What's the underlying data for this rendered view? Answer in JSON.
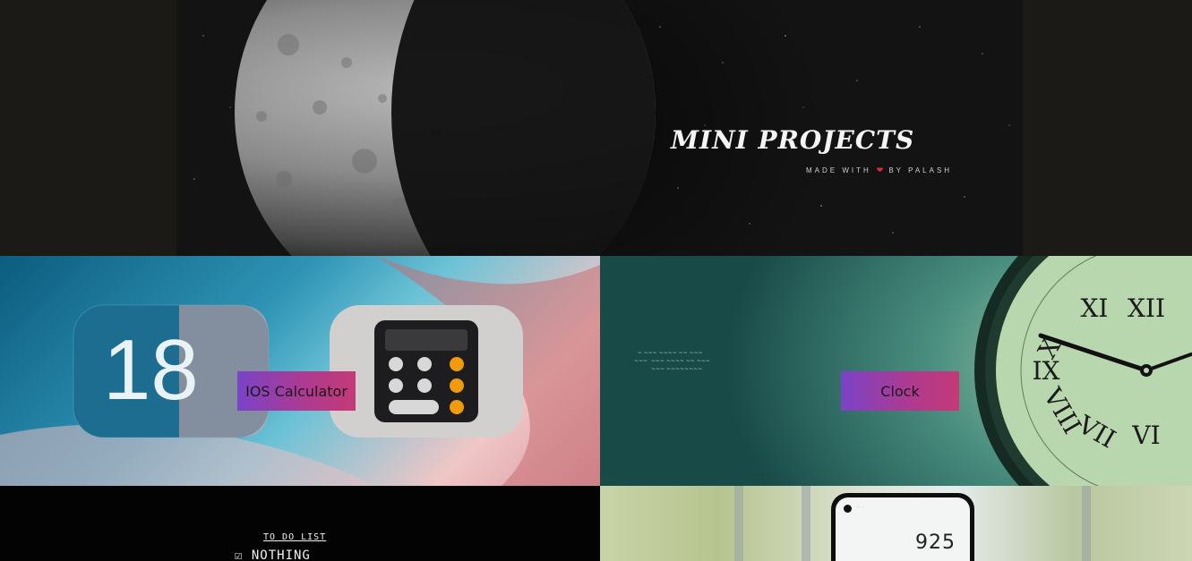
{
  "hero": {
    "title": "MINI PROJECTS",
    "made_with": "MADE WITH",
    "by": "BY PALASH",
    "heart_color": "#e02a3a"
  },
  "projects": [
    {
      "label": "IOS Calculator",
      "calendar_number": "18"
    },
    {
      "label": "Clock"
    },
    {
      "todo_title": "TO DO LIST",
      "todo_item": "☑ NOTHING"
    },
    {
      "phone_readout": "925"
    }
  ],
  "colors": {
    "button_gradient_start": "#7a43c8",
    "button_gradient_end": "#c43a76",
    "page_background": "#1b1a17"
  }
}
